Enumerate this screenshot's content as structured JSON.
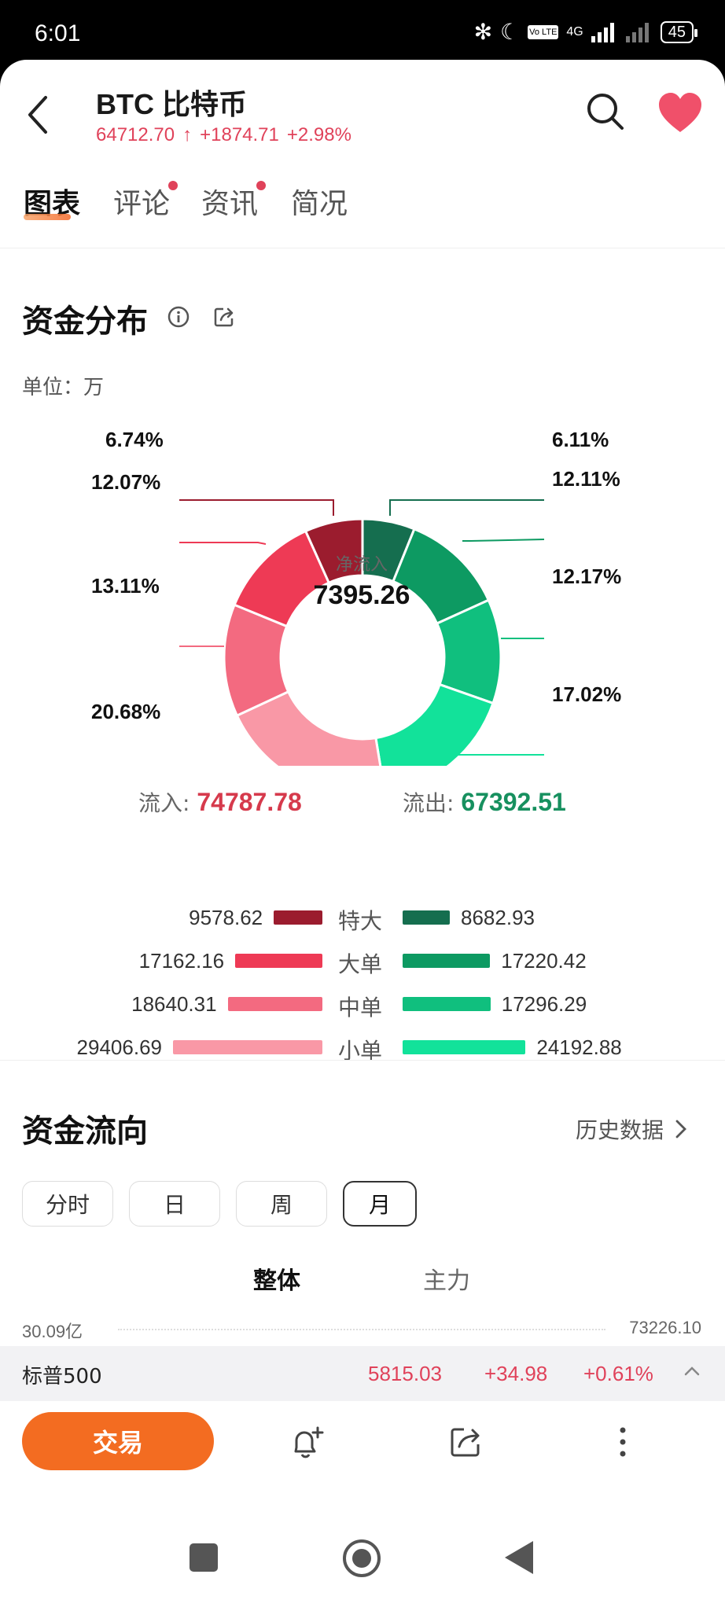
{
  "status": {
    "time": "6:01",
    "bt": "✻",
    "moon": "☾",
    "volte": "Vo LTE",
    "net": "4G",
    "battery": "45"
  },
  "header": {
    "title": "BTC  比特币",
    "price": "64712.70",
    "arrow": "↑",
    "change": "+1874.71",
    "change_pct": "+2.98%"
  },
  "tabs": [
    {
      "label": "图表",
      "active": true,
      "dot": false
    },
    {
      "label": "评论",
      "active": false,
      "dot": true
    },
    {
      "label": "资讯",
      "active": false,
      "dot": true
    },
    {
      "label": "简况",
      "active": false,
      "dot": false
    }
  ],
  "distribution": {
    "title": "资金分布",
    "unit": "单位：万",
    "center_label": "净流入",
    "center_value": "7395.26",
    "inflow_label": "流入: ",
    "inflow_value": "74787.78",
    "outflow_label": "流出: ",
    "outflow_value": "67392.51",
    "left_pcts": [
      "6.74%",
      "12.07%",
      "13.11%",
      "20.68%"
    ],
    "right_pcts": [
      "6.11%",
      "12.11%",
      "12.17%",
      "17.02%"
    ],
    "rows": [
      {
        "label": "特大",
        "in": "9578.62",
        "out": "8682.93"
      },
      {
        "label": "大单",
        "in": "17162.16",
        "out": "17220.42"
      },
      {
        "label": "中单",
        "in": "18640.31",
        "out": "17296.29"
      },
      {
        "label": "小单",
        "in": "29406.69",
        "out": "24192.88"
      }
    ],
    "colors": {
      "in": [
        "#9b1c2e",
        "#ee3a55",
        "#f36a80",
        "#f998a6"
      ],
      "out": [
        "#156e4f",
        "#0d9a62",
        "#10bf7e",
        "#12e29a"
      ]
    }
  },
  "flow": {
    "title": "资金流向",
    "history": "历史数据",
    "periods": [
      "分时",
      "日",
      "周",
      "月"
    ],
    "active_period": "月",
    "segments": [
      "整体",
      "主力"
    ],
    "axis_left": "30.09亿",
    "axis_right": "73226.10"
  },
  "ticker": {
    "name": "标普500",
    "price": "5815.03",
    "change": "+34.98",
    "pct": "+0.61%"
  },
  "actions": {
    "trade": "交易"
  },
  "icons": [
    "back-icon",
    "search-icon",
    "heart-icon",
    "info-icon",
    "share-icon",
    "chevron-right-icon",
    "bell-plus-icon",
    "share-icon",
    "more-icon",
    "chevron-up-icon",
    "nav-recents-icon",
    "nav-home-icon",
    "nav-back-icon"
  ]
}
